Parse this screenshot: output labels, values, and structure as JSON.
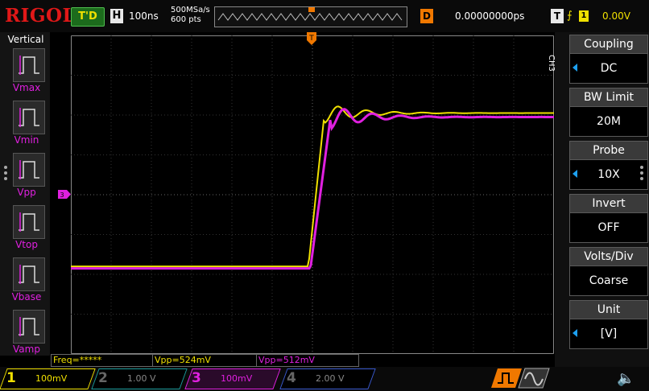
{
  "brand": "RIGOL",
  "status": {
    "trigger_state": "T'D",
    "timebase_key": "H",
    "timebase": "100ns",
    "sample_rate": "500MSa/s",
    "memory_depth": "600  pts",
    "delay_key": "D",
    "delay": "0.00000000ps",
    "trigger_key": "T",
    "trigger_edge": "⨍",
    "trigger_source": "1",
    "trigger_level": "0.00V",
    "pos_marker": "T"
  },
  "left_panel": {
    "title": "Vertical",
    "items": [
      {
        "label": "Vmax"
      },
      {
        "label": "Vmin"
      },
      {
        "label": "Vpp"
      },
      {
        "label": "Vtop"
      },
      {
        "label": "Vbase"
      },
      {
        "label": "Vamp"
      }
    ]
  },
  "markers": {
    "ch3_offset": "3",
    "trigger_level": "T"
  },
  "right_menu": {
    "channel": "CH3",
    "items": [
      {
        "title": "Coupling",
        "value": "DC",
        "arrow": true
      },
      {
        "title": "BW Limit",
        "value": "20M",
        "arrow": false
      },
      {
        "title": "Probe",
        "value": "10X",
        "arrow": true
      },
      {
        "title": "Invert",
        "value": "OFF",
        "arrow": false
      },
      {
        "title": "Volts/Div",
        "value": "Coarse",
        "arrow": false
      },
      {
        "title": "Unit",
        "value": "[V]",
        "arrow": true
      }
    ]
  },
  "measurements": [
    {
      "text": "Freq=*****",
      "color": "#f0e000"
    },
    {
      "text": "Vpp=524mV",
      "color": "#f0e000"
    },
    {
      "text": "Vpp=512mV",
      "color": "#e020e0"
    }
  ],
  "channels": [
    {
      "num": "1",
      "scale": "100mV",
      "color": "#f0e000",
      "active": true
    },
    {
      "num": "2",
      "scale": "1.00 V",
      "color": "#1a9a9a",
      "active": false
    },
    {
      "num": "3",
      "scale": "100mV",
      "color": "#e020e0",
      "active": true
    },
    {
      "num": "4",
      "scale": "2.00 V",
      "color": "#3a5ad0",
      "active": false
    }
  ],
  "colors": {
    "ch1": "#f0e000",
    "ch3": "#e020e0",
    "trigger": "#f07800",
    "accent": "#1da0f0"
  },
  "waveforms": {
    "ch1": {
      "low_div": -1.8,
      "high_div": 2.05,
      "rise_start_div": -0.1,
      "rise_end_div": 0.3
    },
    "ch3": {
      "low_div": -1.85,
      "high_div": 1.95,
      "rise_start_div": -0.05,
      "rise_end_div": 0.45
    }
  }
}
